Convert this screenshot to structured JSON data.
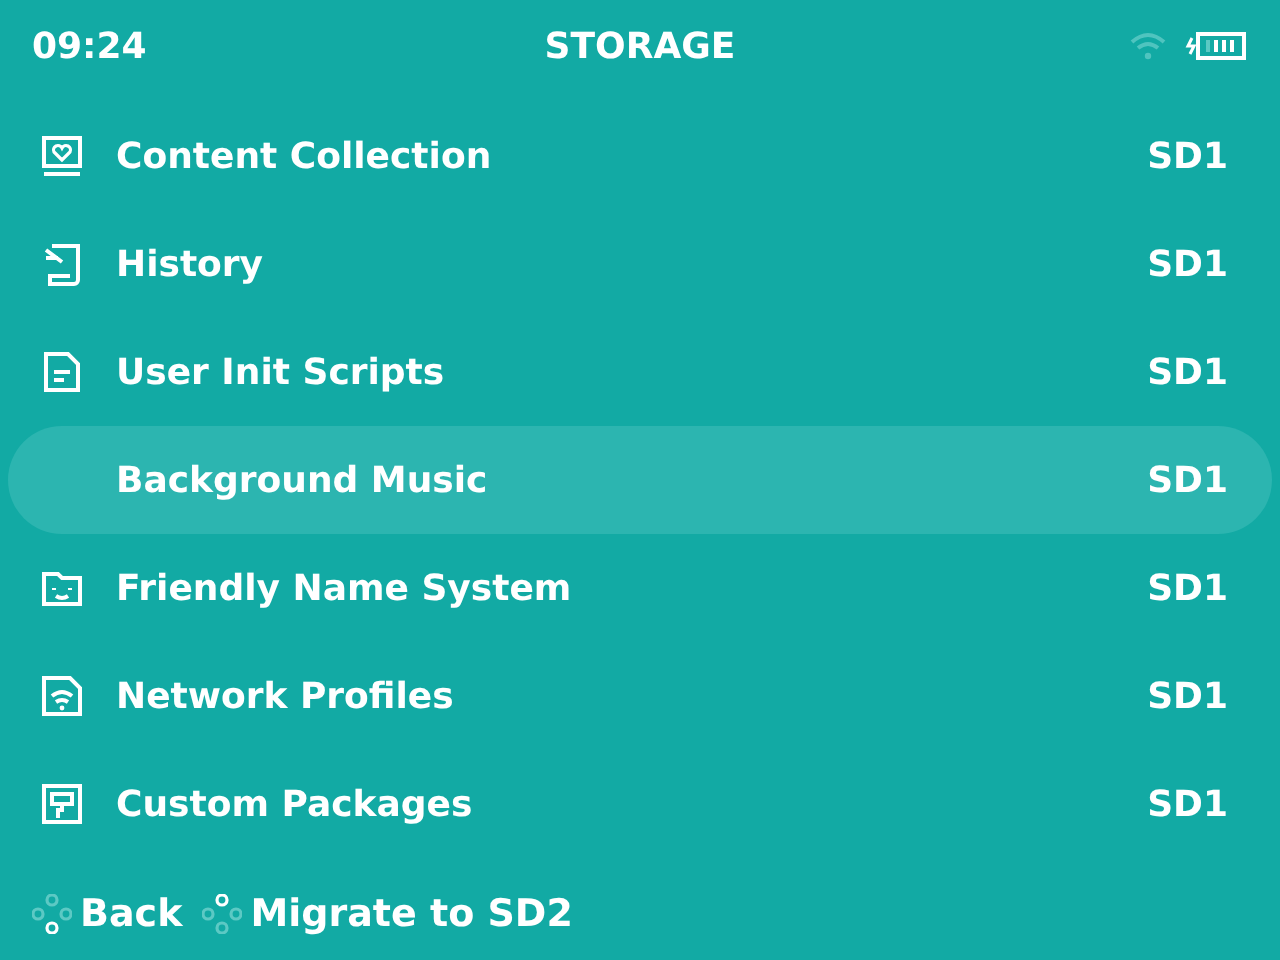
{
  "status_bar": {
    "time": "09:24",
    "title": "STORAGE"
  },
  "items": [
    {
      "kind": "collection",
      "label": "Content Collection",
      "value": "SD1",
      "selected": false
    },
    {
      "kind": "history",
      "label": "History",
      "value": "SD1",
      "selected": false
    },
    {
      "kind": "script",
      "label": "User Init Scripts",
      "value": "SD1",
      "selected": false
    },
    {
      "label": "Background Music",
      "value": "SD1",
      "selected": true
    },
    {
      "kind": "folder",
      "label": "Friendly Name System",
      "value": "SD1",
      "selected": false
    },
    {
      "kind": "network",
      "label": "Network Profiles",
      "value": "SD1",
      "selected": false
    },
    {
      "kind": "package",
      "label": "Custom Packages",
      "value": "SD1",
      "selected": false
    }
  ],
  "hints": [
    {
      "kind": "south",
      "label": "Back"
    },
    {
      "kind": "north",
      "label": "Migrate to SD2"
    }
  ]
}
